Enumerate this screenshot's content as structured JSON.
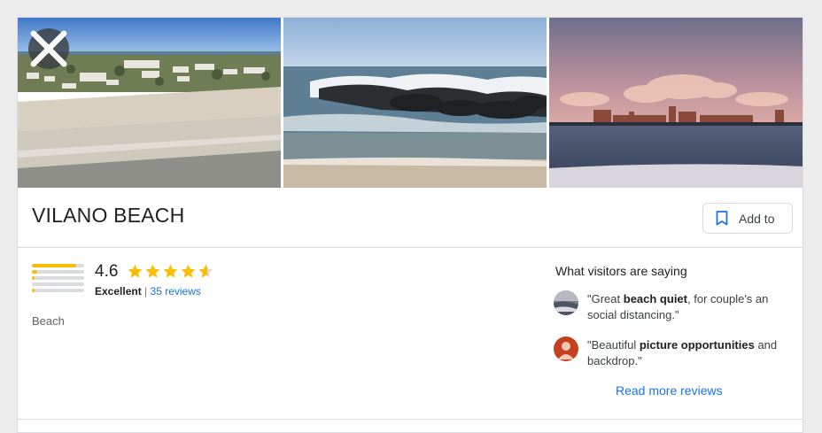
{
  "card": {
    "title": "VILANO BEACH",
    "add_button_label": "Add to",
    "rating": {
      "score": "4.6",
      "stars": 4.6,
      "label": "Excellent",
      "separator": "|",
      "reviews_link": "35 reviews",
      "distribution": [
        0.85,
        0.1,
        0.05,
        0.0,
        0.05
      ]
    },
    "place_type": "Beach",
    "visitors": {
      "title": "What visitors are saying",
      "reviews": [
        {
          "pre": "\"Great ",
          "bold": "beach quiet",
          "post": ", for couple's an social distancing.\""
        },
        {
          "pre": "\"Beautiful ",
          "bold": "picture opportunities",
          "post": " and backdrop.\""
        }
      ],
      "read_more": "Read more reviews"
    }
  },
  "colors": {
    "accent": "#1a73e8",
    "star": "#fbbc04",
    "avatar2": "#c5401e"
  },
  "icons": {
    "close": "close-icon",
    "bookmark": "bookmark-icon",
    "star": "star-icon"
  }
}
